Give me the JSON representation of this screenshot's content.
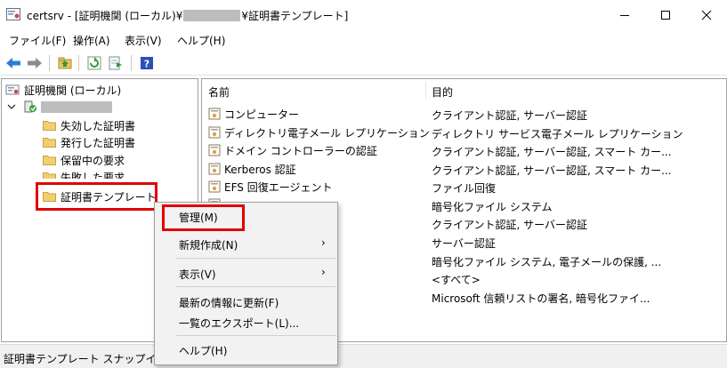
{
  "window": {
    "title_prefix": "certsrv - [証明機関 (ローカル)¥",
    "title_suffix": "¥証明書テンプレート]"
  },
  "menu": [
    {
      "label": "ファイル(F)"
    },
    {
      "label": "操作(A)"
    },
    {
      "label": "表示(V)"
    },
    {
      "label": "ヘルプ(H)"
    }
  ],
  "toolbar": {
    "icons": [
      "back-arrow-icon",
      "forward-arrow-icon",
      "up-folder-icon",
      "refresh-icon",
      "export-list-icon",
      "help-icon"
    ]
  },
  "tree": {
    "root": "証明機関 (ローカル)",
    "children": [
      {
        "label": "失効した証明書"
      },
      {
        "label": "発行した証明書"
      },
      {
        "label": "保留中の要求"
      },
      {
        "label": "失敗した要求"
      },
      {
        "label": "証明書テンプレート"
      }
    ]
  },
  "list": {
    "headers": {
      "name": "名前",
      "purpose": "目的"
    },
    "names": [
      "コンピューター",
      "ディレクトリ電子メール レプリケーション",
      "ドメイン コントローラーの認証",
      "Kerberos 認証",
      "EFS 回復エージェント"
    ],
    "purposes": [
      "クライアント認証, サーバー認証",
      "ディレクトリ サービス電子メール レプリケーション",
      "クライアント認証, サーバー認証, スマート カー...",
      "クライアント認証, サーバー認証, スマート カー...",
      "ファイル回復",
      "暗号化ファイル システム",
      "クライアント認証, サーバー認証",
      "サーバー認証",
      "暗号化ファイル システム, 電子メールの保護, ...",
      "<すべて>",
      "Microsoft 信頼リストの署名, 暗号化ファイ..."
    ]
  },
  "context_menu": {
    "manage": "管理(M)",
    "new": "新規作成(N)",
    "view": "表示(V)",
    "refresh": "最新の情報に更新(F)",
    "export": "一覧のエクスポート(L)...",
    "help": "ヘルプ(H)",
    "submenu_arrow": "›"
  },
  "status": {
    "text": "証明書テンプレート スナップインの"
  },
  "colors": {
    "highlight_box": "#e00000",
    "redaction": "#bdbdbd"
  }
}
